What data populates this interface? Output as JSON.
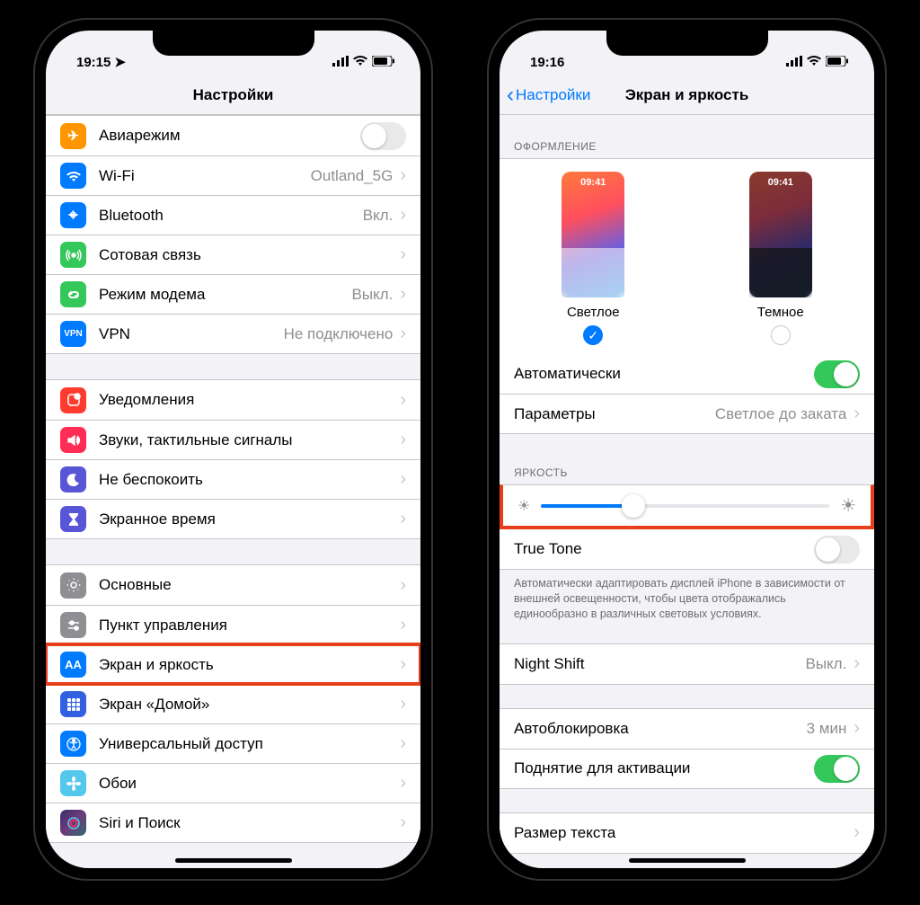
{
  "left": {
    "time": "19:15",
    "title": "Настройки",
    "groups": [
      {
        "header": "",
        "rows": [
          {
            "icon": "airplane",
            "color": "#ff9500",
            "label": "Авиарежим",
            "toggle": "off"
          },
          {
            "icon": "wifi",
            "color": "#007aff",
            "label": "Wi-Fi",
            "value": "Outland_5G",
            "chev": true
          },
          {
            "icon": "bluetooth",
            "color": "#007aff",
            "label": "Bluetooth",
            "value": "Вкл.",
            "chev": true
          },
          {
            "icon": "cellular",
            "color": "#34c759",
            "label": "Сотовая связь",
            "value": "",
            "chev": true
          },
          {
            "icon": "link",
            "color": "#34c759",
            "label": "Режим модема",
            "value": "Выкл.",
            "chev": true
          },
          {
            "icon": "vpn",
            "color": "#007aff",
            "label": "VPN",
            "value": "Не подключено",
            "chev": true
          }
        ]
      },
      {
        "header": "",
        "rows": [
          {
            "icon": "notify",
            "color": "#ff3b30",
            "label": "Уведомления",
            "chev": true
          },
          {
            "icon": "sounds",
            "color": "#ff2d55",
            "label": "Звуки, тактильные сигналы",
            "chev": true
          },
          {
            "icon": "dnd",
            "color": "#5856d6",
            "label": "Не беспокоить",
            "chev": true
          },
          {
            "icon": "screentime",
            "color": "#5856d6",
            "label": "Экранное время",
            "chev": true
          }
        ]
      },
      {
        "header": "",
        "rows": [
          {
            "icon": "general",
            "color": "#8e8e93",
            "label": "Основные",
            "chev": true
          },
          {
            "icon": "control",
            "color": "#8e8e93",
            "label": "Пункт управления",
            "chev": true
          },
          {
            "icon": "display",
            "color": "#007aff",
            "label": "Экран и яркость",
            "chev": true,
            "highlight": true
          },
          {
            "icon": "home",
            "color": "#3360e0",
            "label": "Экран «Домой»",
            "chev": true
          },
          {
            "icon": "access",
            "color": "#007aff",
            "label": "Универсальный доступ",
            "chev": true
          },
          {
            "icon": "wallpaper",
            "color": "#54c7ec",
            "label": "Обои",
            "chev": true
          },
          {
            "icon": "siri",
            "color": "#1c1c1e",
            "label": "Siri и Поиск",
            "chev": true
          }
        ]
      }
    ]
  },
  "right": {
    "time": "19:16",
    "back": "Настройки",
    "title": "Экран и яркость",
    "appearance_header": "ОФОРМЛЕНИЕ",
    "theme_light_label": "Светлое",
    "theme_dark_label": "Темное",
    "thumb_clock": "09:41",
    "auto_label": "Автоматически",
    "params_label": "Параметры",
    "params_value": "Светлое до заката",
    "brightness_header": "ЯРКОСТЬ",
    "brightness_percent": 32,
    "truetone_label": "True Tone",
    "truetone_footer": "Автоматически адаптировать дисплей iPhone в зависимости от внешней освещенности, чтобы цвета отображались единообразно в различных световых условиях.",
    "nightshift_label": "Night Shift",
    "nightshift_value": "Выкл.",
    "autolock_label": "Автоблокировка",
    "autolock_value": "3 мин",
    "raise_label": "Поднятие для активации",
    "textsize_label": "Размер текста"
  }
}
